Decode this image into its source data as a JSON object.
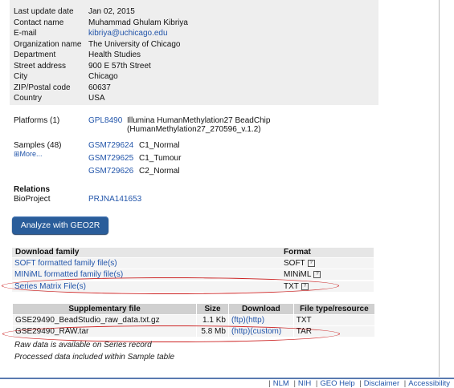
{
  "contact": {
    "rows": [
      {
        "label": "Last update date",
        "value": "Jan 02, 2015"
      },
      {
        "label": "Contact name",
        "value": "Muhammad Ghulam Kibriya"
      },
      {
        "label": "E-mail",
        "value": "kibriya@uchicago.edu"
      },
      {
        "label": "Organization name",
        "value": "The University of Chicago"
      },
      {
        "label": "Department",
        "value": "Health Studies"
      },
      {
        "label": "Street address",
        "value": "900 E 57th Street"
      },
      {
        "label": "City",
        "value": "Chicago"
      },
      {
        "label": "ZIP/Postal code",
        "value": "60637"
      },
      {
        "label": "Country",
        "value": "USA"
      }
    ]
  },
  "platforms": {
    "label": "Platforms (1)",
    "id": "GPL8490",
    "desc_line1": "Illumina HumanMethylation27 BeadChip",
    "desc_line2": "(HumanMethylation27_270596_v.1.2)"
  },
  "samples": {
    "label": "Samples (48)",
    "more": "More...",
    "items": [
      {
        "id": "GSM729624",
        "name": "C1_Normal"
      },
      {
        "id": "GSM729625",
        "name": "C1_Tumour"
      },
      {
        "id": "GSM729626",
        "name": "C2_Normal"
      }
    ]
  },
  "relations": {
    "heading": "Relations",
    "bioproject_label": "BioProject",
    "bioproject_id": "PRJNA141653"
  },
  "analyze_button": "Analyze with GEO2R",
  "download_family": {
    "col_family": "Download family",
    "col_format": "Format",
    "rows": [
      {
        "name": "SOFT formatted family file(s)",
        "format": "SOFT"
      },
      {
        "name": "MINiML formatted family file(s)",
        "format": "MINiML"
      },
      {
        "name": "Series Matrix File(s)",
        "format": "TXT"
      }
    ],
    "help_glyph": "?"
  },
  "supplementary": {
    "headers": [
      "Supplementary file",
      "Size",
      "Download",
      "File type/resource"
    ],
    "rows": [
      {
        "file": "GSE29490_BeadStudio_raw_data.txt.gz",
        "size": "1.1 Kb",
        "dl1": "(ftp)",
        "dl2": "(http)",
        "type": "TXT"
      },
      {
        "file": "GSE29490_RAW.tar",
        "size": "5.8 Mb",
        "dl1": "(http)",
        "dl2": "(custom)",
        "type": "TAR"
      }
    ],
    "note1": "Raw data is available on Series record",
    "note2": "Processed data included within Sample table"
  },
  "footer": {
    "links": [
      "NLM",
      "NIH",
      "GEO Help",
      "Disclaimer",
      "Accessibility"
    ]
  },
  "colors": {
    "link": "#2255aa",
    "button": "#2a5d9a",
    "highlight_ellipse": "#cc2222",
    "infobox": "#eeeeee"
  }
}
